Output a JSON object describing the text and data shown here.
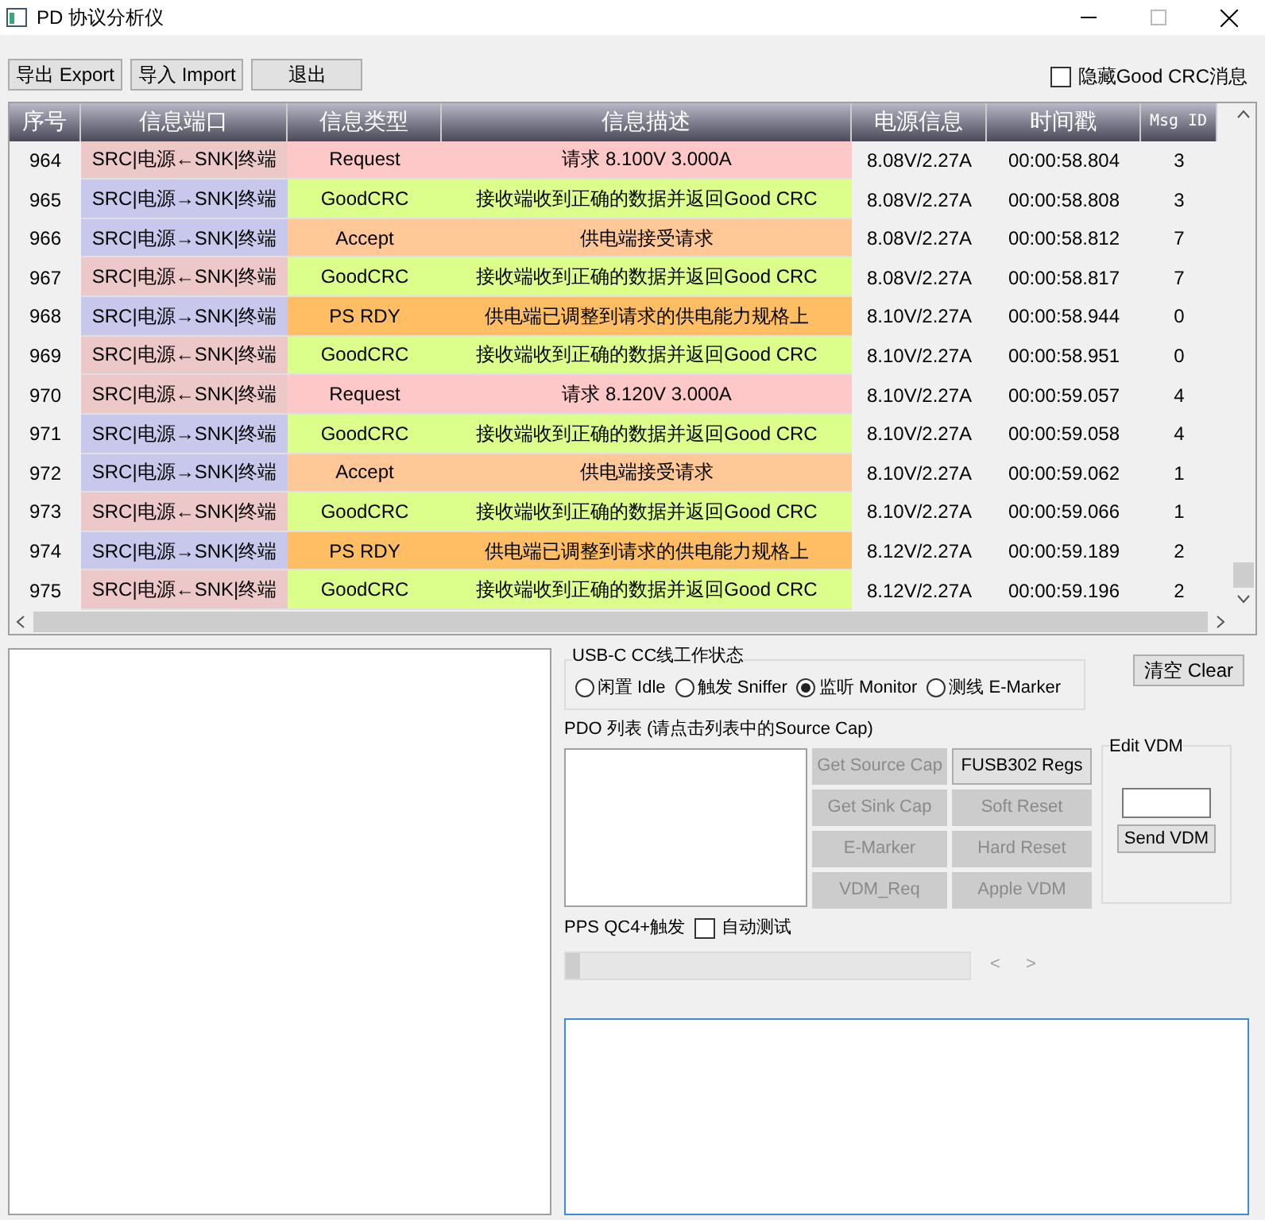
{
  "window": {
    "title": "PD 协议分析仪"
  },
  "toolbar": {
    "buttons": [
      "导出 Export",
      "导入 Import",
      "退出"
    ],
    "hide_goodcrc": {
      "label": "隐藏Good CRC消息",
      "checked": false
    }
  },
  "table": {
    "columns": [
      "序号",
      "信息端口",
      "信息类型",
      "信息描述",
      "电源信息",
      "时间戳",
      "Msg ID"
    ],
    "rows": [
      {
        "seq": "964",
        "port": {
          "text": "SRC|电源←SNK|终端",
          "color": "#ecc8c8"
        },
        "type": {
          "text": "Request",
          "color": "#ffc8c8"
        },
        "desc": "请求 8.100V 3.000A",
        "power": "8.08V/2.27A",
        "time": "00:00:58.804",
        "msg_id": "3"
      },
      {
        "seq": "965",
        "port": {
          "text": "SRC|电源→SNK|终端",
          "color": "#c8c8ec"
        },
        "type": {
          "text": "GoodCRC",
          "color": "#dcff8c"
        },
        "desc": "接收端收到正确的数据并返回Good CRC",
        "power": "8.08V/2.27A",
        "time": "00:00:58.808",
        "msg_id": "3"
      },
      {
        "seq": "966",
        "port": {
          "text": "SRC|电源→SNK|终端",
          "color": "#c8c8ec"
        },
        "type": {
          "text": "Accept",
          "color": "#ffc896"
        },
        "desc": "供电端接受请求",
        "power": "8.08V/2.27A",
        "time": "00:00:58.812",
        "msg_id": "7"
      },
      {
        "seq": "967",
        "port": {
          "text": "SRC|电源←SNK|终端",
          "color": "#ecc8c8"
        },
        "type": {
          "text": "GoodCRC",
          "color": "#dcff8c"
        },
        "desc": "接收端收到正确的数据并返回Good CRC",
        "power": "8.08V/2.27A",
        "time": "00:00:58.817",
        "msg_id": "7"
      },
      {
        "seq": "968",
        "port": {
          "text": "SRC|电源→SNK|终端",
          "color": "#c8c8ec"
        },
        "type": {
          "text": "PS RDY",
          "color": "#ffbe64"
        },
        "desc": "供电端已调整到请求的供电能力规格上",
        "power": "8.10V/2.27A",
        "time": "00:00:58.944",
        "msg_id": "0"
      },
      {
        "seq": "969",
        "port": {
          "text": "SRC|电源←SNK|终端",
          "color": "#ecc8c8"
        },
        "type": {
          "text": "GoodCRC",
          "color": "#dcff8c"
        },
        "desc": "接收端收到正确的数据并返回Good CRC",
        "power": "8.10V/2.27A",
        "time": "00:00:58.951",
        "msg_id": "0"
      },
      {
        "seq": "970",
        "port": {
          "text": "SRC|电源←SNK|终端",
          "color": "#ecc8c8"
        },
        "type": {
          "text": "Request",
          "color": "#ffc8c8"
        },
        "desc": "请求 8.120V 3.000A",
        "power": "8.10V/2.27A",
        "time": "00:00:59.057",
        "msg_id": "4"
      },
      {
        "seq": "971",
        "port": {
          "text": "SRC|电源→SNK|终端",
          "color": "#c8c8ec"
        },
        "type": {
          "text": "GoodCRC",
          "color": "#dcff8c"
        },
        "desc": "接收端收到正确的数据并返回Good CRC",
        "power": "8.10V/2.27A",
        "time": "00:00:59.058",
        "msg_id": "4"
      },
      {
        "seq": "972",
        "port": {
          "text": "SRC|电源→SNK|终端",
          "color": "#c8c8ec"
        },
        "type": {
          "text": "Accept",
          "color": "#ffc896"
        },
        "desc": "供电端接受请求",
        "power": "8.10V/2.27A",
        "time": "00:00:59.062",
        "msg_id": "1"
      },
      {
        "seq": "973",
        "port": {
          "text": "SRC|电源←SNK|终端",
          "color": "#ecc8c8"
        },
        "type": {
          "text": "GoodCRC",
          "color": "#dcff8c"
        },
        "desc": "接收端收到正确的数据并返回Good CRC",
        "power": "8.10V/2.27A",
        "time": "00:00:59.066",
        "msg_id": "1"
      },
      {
        "seq": "974",
        "port": {
          "text": "SRC|电源→SNK|终端",
          "color": "#c8c8ec"
        },
        "type": {
          "text": "PS RDY",
          "color": "#ffbe64"
        },
        "desc": "供电端已调整到请求的供电能力规格上",
        "power": "8.12V/2.27A",
        "time": "00:00:59.189",
        "msg_id": "2"
      },
      {
        "seq": "975",
        "port": {
          "text": "SRC|电源←SNK|终端",
          "color": "#ecc8c8"
        },
        "type": {
          "text": "GoodCRC",
          "color": "#dcff8c"
        },
        "desc": "接收端收到正确的数据并返回Good CRC",
        "power": "8.12V/2.27A",
        "time": "00:00:59.196",
        "msg_id": "2"
      }
    ]
  },
  "cc_mode": {
    "title": "USB-C CC线工作状态",
    "options": [
      {
        "label": "闲置 Idle",
        "selected": false
      },
      {
        "label": "触发 Sniffer",
        "selected": false
      },
      {
        "label": "监听 Monitor",
        "selected": true
      },
      {
        "label": "测线 E-Marker",
        "selected": false
      }
    ]
  },
  "clear_button": "清空 Clear",
  "pdo": {
    "title": "PDO 列表 (请点击列表中的Source Cap)",
    "buttons": [
      {
        "label": "Get Source Cap",
        "disabled": true
      },
      {
        "label": "FUSB302 Regs",
        "disabled": false
      },
      {
        "label": "Get Sink Cap",
        "disabled": true
      },
      {
        "label": "Soft Reset",
        "disabled": true
      },
      {
        "label": "E-Marker",
        "disabled": true
      },
      {
        "label": "Hard Reset",
        "disabled": true
      },
      {
        "label": "VDM_Req",
        "disabled": true
      },
      {
        "label": "Apple VDM",
        "disabled": true
      }
    ]
  },
  "vdm": {
    "title": "Edit VDM",
    "button": "Send VDM"
  },
  "pps": {
    "title": "PPS QC4+触发",
    "auto_test": {
      "label": "自动测试",
      "checked": false
    },
    "level": 0,
    "prev": "<",
    "next": ">"
  }
}
